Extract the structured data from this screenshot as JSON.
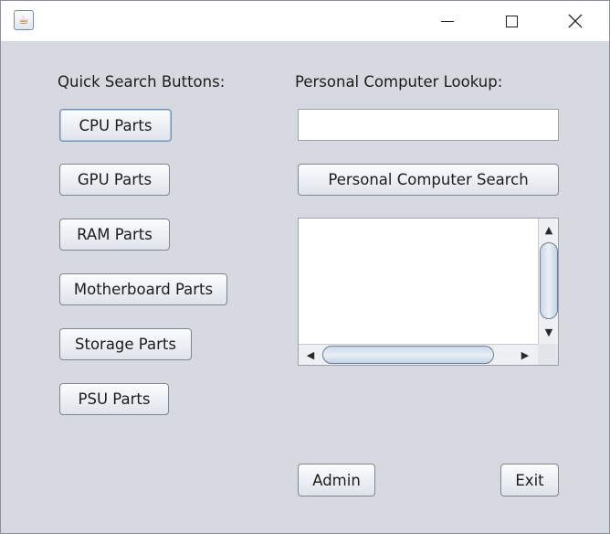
{
  "window": {
    "icon": "java-cup-icon",
    "controls": {
      "minimize": "minimize-icon",
      "maximize": "maximize-icon",
      "close": "close-icon"
    }
  },
  "quick_search": {
    "heading": "Quick Search Buttons:",
    "buttons": [
      {
        "label": "CPU Parts"
      },
      {
        "label": "GPU Parts"
      },
      {
        "label": "RAM Parts"
      },
      {
        "label": "Motherboard Parts"
      },
      {
        "label": "Storage Parts"
      },
      {
        "label": "PSU Parts"
      }
    ]
  },
  "pc_lookup": {
    "heading": "Personal Computer Lookup:",
    "input_value": "",
    "search_button": "Personal Computer Search"
  },
  "footer": {
    "admin_button": "Admin",
    "exit_button": "Exit"
  },
  "colors": {
    "window_bg": "#d6d9df",
    "titlebar_bg": "#ffffff",
    "scroll_thumb": "#c9d8ea"
  }
}
